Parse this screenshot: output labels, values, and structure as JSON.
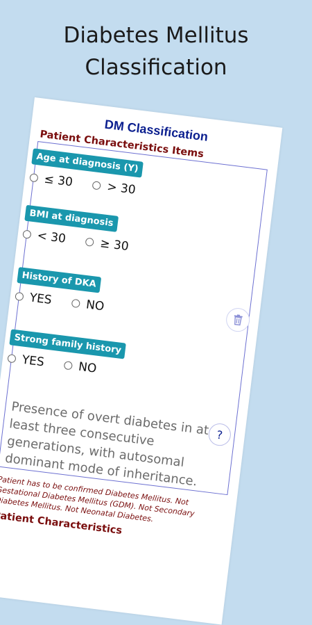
{
  "promo": {
    "title_line1": "Diabetes Mellitus",
    "title_line2": "Classification"
  },
  "app": {
    "title": "DM Classification",
    "section_header": "Patient Characteristics Items",
    "questions": [
      {
        "label": "Age at diagnosis (Y)",
        "options": [
          "≤ 30",
          "> 30"
        ]
      },
      {
        "label": "BMI at diagnosis",
        "options": [
          "< 30",
          "≥ 30"
        ]
      },
      {
        "label": "History of DKA",
        "options": [
          "YES",
          "NO"
        ]
      },
      {
        "label": "Strong family history",
        "options": [
          "YES",
          "NO"
        ]
      }
    ],
    "description": "Presence of overt diabetes in at least three consecutive generations, with autosomal dominant mode of inheritance.",
    "help_label": "?",
    "note": "Patient has to be confirmed Diabetes Mellitus. Not Gestational Diabetes Mellitus (GDM). Not Secondary Diabetes Mellitus. Not Neonatal Diabetes.",
    "footer_header": "Patient Characteristics"
  },
  "icons": {
    "trash": "trash-icon",
    "help": "help-icon"
  },
  "colors": {
    "background": "#c3dcef",
    "badge": "#1a97ad",
    "title": "#0b1f8f",
    "section": "#7a0e0e"
  }
}
